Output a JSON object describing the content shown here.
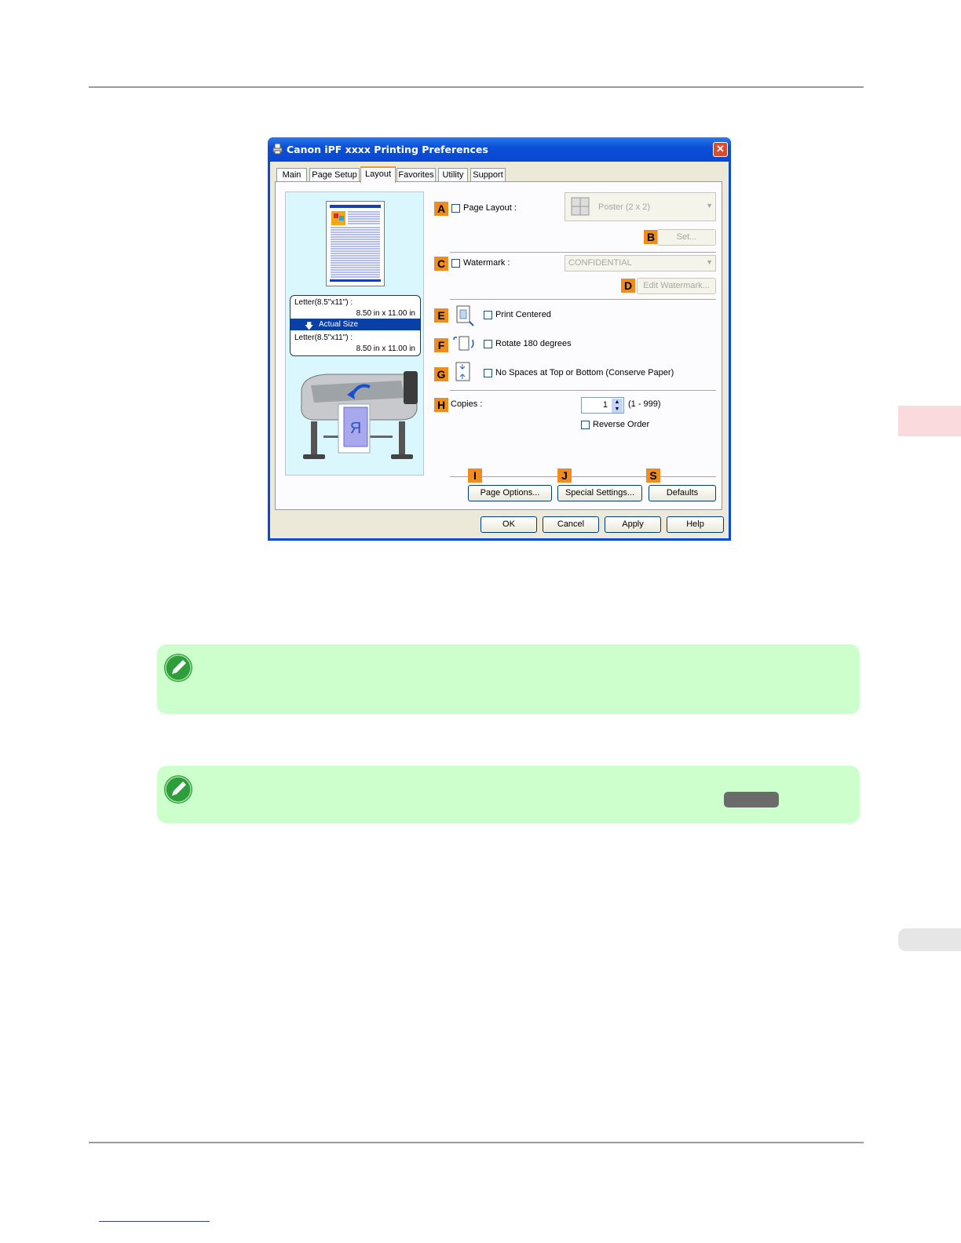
{
  "dialog": {
    "title": "Canon iPF xxxx Printing Preferences",
    "close_glyph": "✕",
    "tabs": [
      {
        "label": "Main"
      },
      {
        "label": "Page Setup"
      },
      {
        "label": "Layout"
      },
      {
        "label": "Favorites"
      },
      {
        "label": "Utility"
      },
      {
        "label": "Support"
      }
    ],
    "active_tab": "Layout",
    "preview": {
      "size_line1": "Letter(8.5\"x11\") :",
      "size_line2": "8.50 in x 11.00 in",
      "scaling": "Actual Size",
      "size_line3": "Letter(8.5\"x11\") :",
      "size_line4": "8.50 in x 11.00 in",
      "paper_letter": "R"
    },
    "callouts": {
      "a": "A",
      "b": "B",
      "c": "C",
      "d": "D",
      "e": "E",
      "f": "F",
      "g": "G",
      "h": "H",
      "i": "I",
      "j": "J",
      "s": "S"
    },
    "page_layout": {
      "label": "Page Layout :",
      "checked": false,
      "value": "Poster (2 x 2)",
      "set_button": "Set..."
    },
    "watermark": {
      "label": "Watermark :",
      "checked": false,
      "value": "CONFIDENTIAL",
      "edit_button": "Edit Watermark..."
    },
    "print_centered": {
      "label": "Print Centered",
      "checked": false
    },
    "rotate": {
      "label": "Rotate 180 degrees",
      "checked": false
    },
    "no_spaces": {
      "label": "No Spaces at Top or Bottom (Conserve Paper)",
      "checked": false
    },
    "copies": {
      "label": "Copies :",
      "value": "1",
      "range": "(1 - 999)",
      "reverse_order_label": "Reverse Order",
      "reverse_order_checked": false
    },
    "buttons": {
      "page_options": "Page Options...",
      "special_settings": "Special Settings...",
      "defaults": "Defaults",
      "ok": "OK",
      "cancel": "Cancel",
      "apply": "Apply",
      "help": "Help"
    }
  },
  "colors": {
    "callout": "#f08c1e",
    "note_bg": "#ccffcc",
    "side_tab": "#fadadd",
    "titlebar": "#0a50d8"
  },
  "icons": [
    "printer-icon",
    "close-icon",
    "note-pencil-icon",
    "arrow-down-icon",
    "spin-up-icon",
    "spin-down-icon",
    "dropdown-arrow-icon"
  ]
}
